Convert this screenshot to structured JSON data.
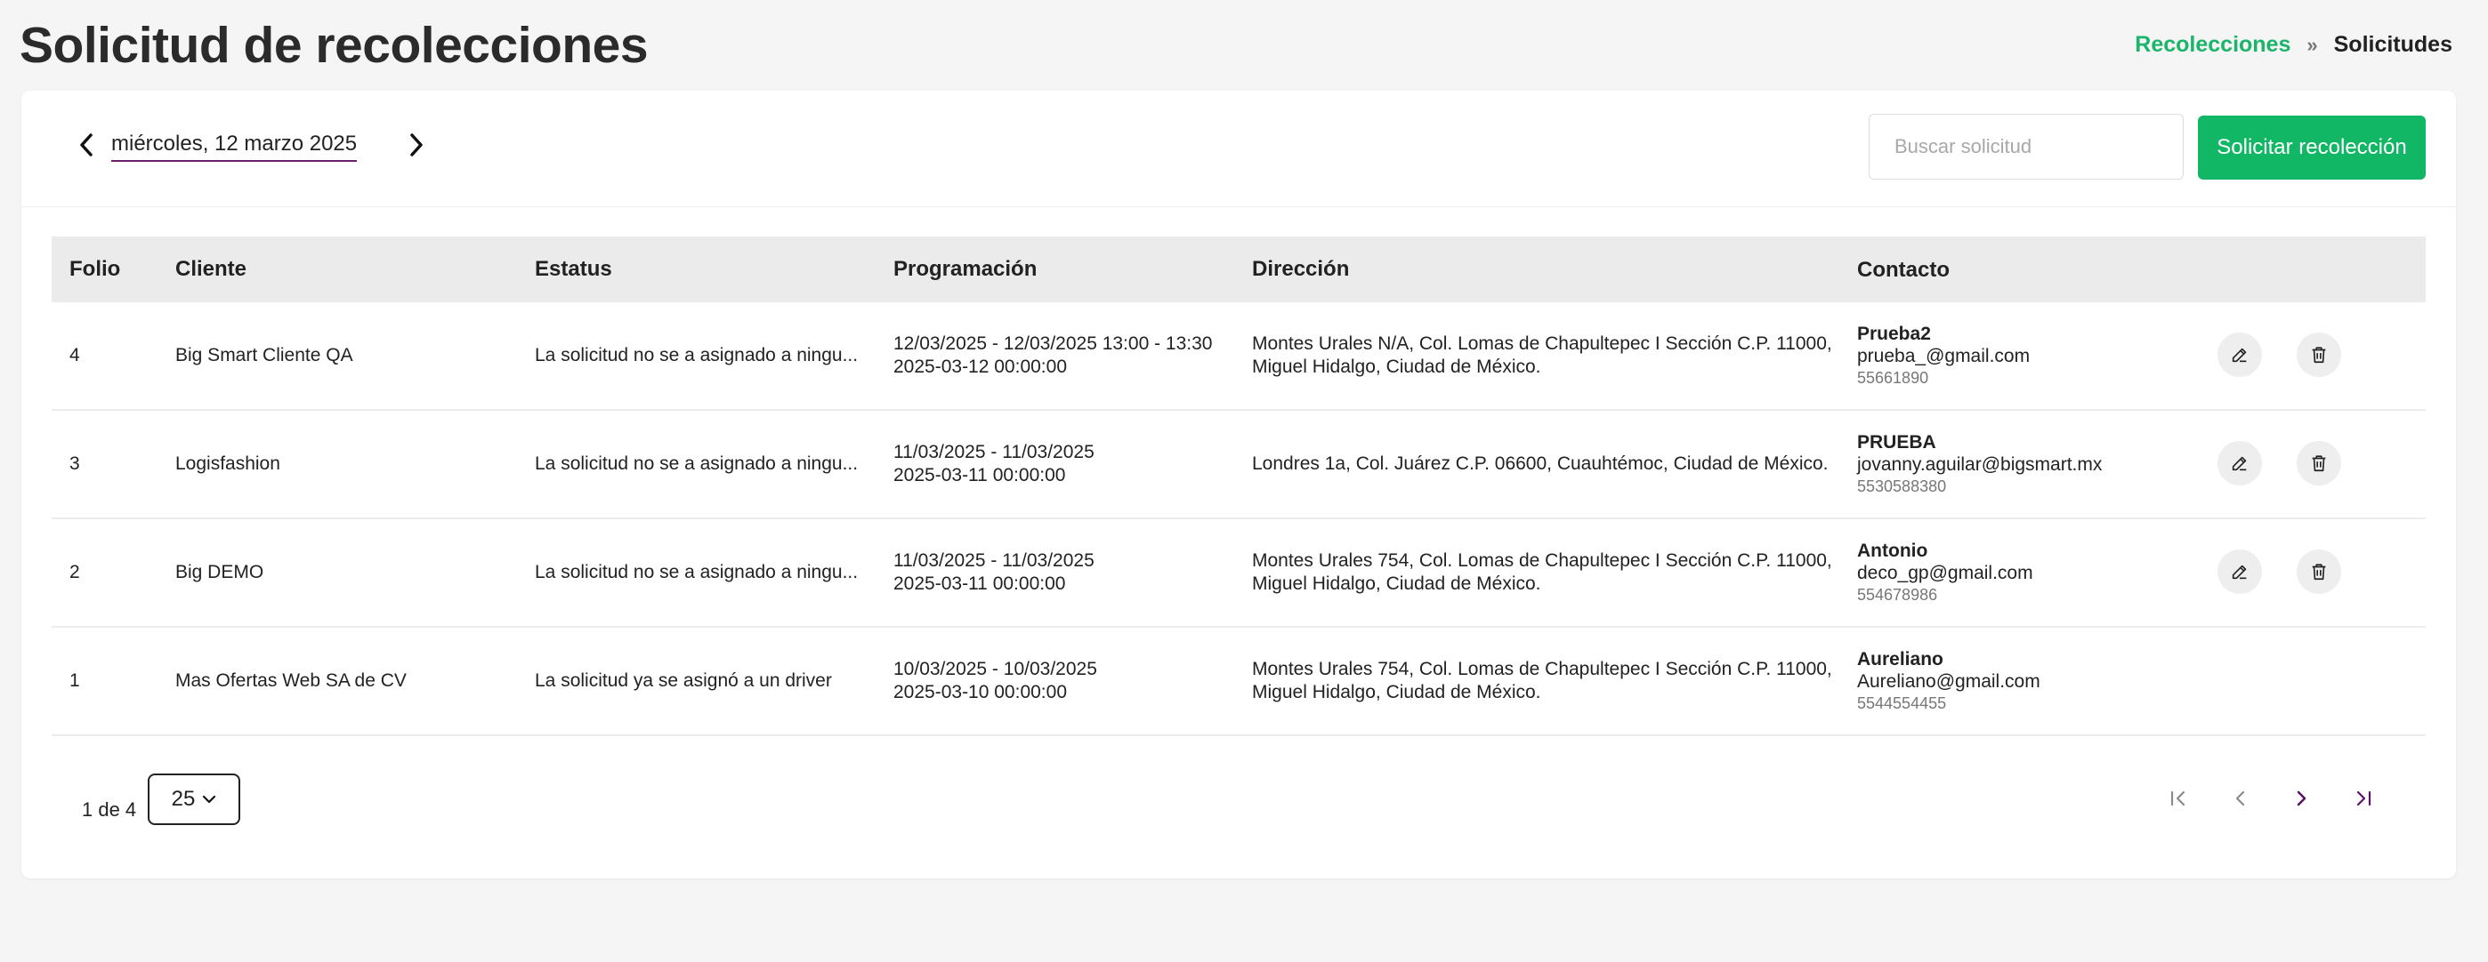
{
  "header": {
    "title": "Solicitud de recolecciones",
    "breadcrumb": {
      "parent": "Recolecciones",
      "separator": "»",
      "current": "Solicitudes"
    }
  },
  "toolbar": {
    "date": "miércoles, 12 marzo 2025",
    "search_placeholder": "Buscar solicitud",
    "request_button": "Solicitar recolección"
  },
  "table": {
    "columns": [
      "Folio",
      "Cliente",
      "Estatus",
      "Programación",
      "Dirección",
      "Contacto"
    ],
    "rows": [
      {
        "folio": "4",
        "cliente": "Big Smart Cliente QA",
        "estatus": "La solicitud no se a asignado a ningu...",
        "prog_range": "12/03/2025 - 12/03/2025 13:00 - 13:30",
        "prog_date": "2025-03-12 00:00:00",
        "dir_line1": "Montes Urales N/A, Col. Lomas de Chapultepec I Sección C.P. 11000,",
        "dir_line2": "Miguel Hidalgo, Ciudad de México.",
        "contact_name": "Prueba2",
        "contact_email": "prueba_@gmail.com",
        "contact_phone": "55661890",
        "actions": true
      },
      {
        "folio": "3",
        "cliente": "Logisfashion",
        "estatus": "La solicitud no se a asignado a ningu...",
        "prog_range": "11/03/2025 - 11/03/2025",
        "prog_date": "2025-03-11 00:00:00",
        "dir_line1": "Londres 1a, Col. Juárez C.P. 06600, Cuauhtémoc, Ciudad de México.",
        "dir_line2": "",
        "contact_name": "PRUEBA",
        "contact_email": "jovanny.aguilar@bigsmart.mx",
        "contact_phone": "5530588380",
        "actions": true
      },
      {
        "folio": "2",
        "cliente": "Big DEMO",
        "estatus": "La solicitud no se a asignado a ningu...",
        "prog_range": "11/03/2025 - 11/03/2025",
        "prog_date": "2025-03-11 00:00:00",
        "dir_line1": "Montes Urales 754, Col. Lomas de Chapultepec I Sección C.P. 11000,",
        "dir_line2": "Miguel Hidalgo, Ciudad de México.",
        "contact_name": "Antonio",
        "contact_email": "deco_gp@gmail.com",
        "contact_phone": "554678986",
        "actions": true
      },
      {
        "folio": "1",
        "cliente": "Mas Ofertas Web SA de CV",
        "estatus": "La solicitud ya se asignó a un driver",
        "prog_range": "10/03/2025 - 10/03/2025",
        "prog_date": "2025-03-10 00:00:00",
        "dir_line1": "Montes Urales 754, Col. Lomas de Chapultepec I Sección C.P. 11000,",
        "dir_line2": "Miguel Hidalgo, Ciudad de México.",
        "contact_name": "Aureliano",
        "contact_email": "Aureliano@gmail.com",
        "contact_phone": "5544554455",
        "actions": false
      }
    ]
  },
  "pagination": {
    "info": "1 de 4",
    "page_size": "25"
  },
  "icons": {
    "prev_date": "chevron-left-icon",
    "next_date": "chevron-right-icon",
    "edit": "pencil-icon",
    "delete": "trash-icon",
    "first": "first-page-icon",
    "prev": "previous-page-icon",
    "next": "next-page-icon",
    "last": "last-page-icon"
  },
  "colors": {
    "accent": "#12b765",
    "breadcrumb_link": "#1ab46a",
    "pager_active": "#5a1466",
    "underline": "#6b1d6b"
  }
}
